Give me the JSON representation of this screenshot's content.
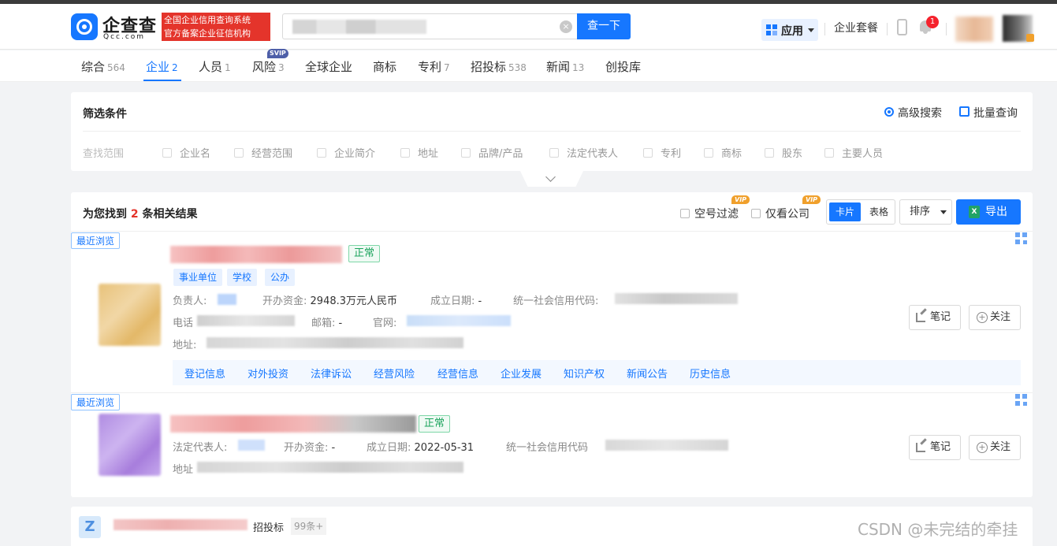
{
  "header": {
    "logo_text": "企查查",
    "logo_sub": "Qcc.com",
    "logo_badge_line1": "全国企业信用查询系统",
    "logo_badge_line2": "官方备案企业征信机构",
    "search_button": "查一下",
    "clear_icon": "×",
    "apps_label": "应用",
    "package_link": "企业套餐",
    "notification_count": "1"
  },
  "tabs": [
    {
      "label": "综合",
      "count": "564"
    },
    {
      "label": "企业",
      "count": "2"
    },
    {
      "label": "人员",
      "count": "1"
    },
    {
      "label": "风险",
      "count": "3"
    },
    {
      "label": "全球企业",
      "count": ""
    },
    {
      "label": "商标",
      "count": ""
    },
    {
      "label": "专利",
      "count": "7"
    },
    {
      "label": "招投标",
      "count": "538"
    },
    {
      "label": "新闻",
      "count": "13"
    },
    {
      "label": "创投库",
      "count": ""
    }
  ],
  "risk_badge": "SVIP",
  "filter": {
    "title": "筛选条件",
    "advanced_search": "高级搜索",
    "batch_query": "批量查询",
    "scope_label": "查找范围",
    "options": [
      "企业名",
      "经营范围",
      "企业简介",
      "地址",
      "品牌/产品",
      "法定代表人",
      "专利",
      "商标",
      "股东",
      "主要人员"
    ]
  },
  "results": {
    "summary_prefix": "为您找到",
    "summary_count": "2",
    "summary_suffix": "条相关结果",
    "empty_filter": "空号过滤",
    "company_only": "仅看公司",
    "vip_tag": "VIP",
    "view_card": "卡片",
    "view_table": "表格",
    "sort_label": "排序",
    "export_label": "导出",
    "excel_icon_letter": "X"
  },
  "companies": [
    {
      "recent_tag": "最近浏览",
      "status": "正常",
      "chips": [
        "事业单位",
        "学校",
        "公办"
      ],
      "principal_label": "负责人:",
      "capital_label": "开办资金:",
      "capital_value": "2948.3万元人民币",
      "founded_label": "成立日期:",
      "founded_value": "-",
      "credit_code_label": "统一社会信用代码:",
      "phone_label": "电话",
      "email_label": "邮箱:",
      "email_value": "-",
      "website_label": "官网:",
      "address_label": "地址:",
      "links": [
        "登记信息",
        "对外投资",
        "法律诉讼",
        "经营风险",
        "经营信息",
        "企业发展",
        "知识产权",
        "新闻公告",
        "历史信息"
      ],
      "note_button": "笔记",
      "follow_button": "关注"
    },
    {
      "recent_tag": "最近浏览",
      "status": "正常",
      "legal_rep_label": "法定代表人:",
      "capital_label": "开办资金:",
      "capital_value": "-",
      "founded_label": "成立日期:",
      "founded_value": "2022-05-31",
      "credit_code_label": "统一社会信用代码",
      "address_label": "地址",
      "note_button": "笔记",
      "follow_button": "关注"
    }
  ],
  "bottom_item": {
    "icon_letter": "Z",
    "label": "招投标",
    "count": "99条+"
  },
  "watermark": "CSDN @未完结的牵挂",
  "colors": {
    "brand_blue": "#1677ff",
    "badge_red": "#e4342b",
    "status_green": "#19a35b",
    "vip_orange": "#f0a02c"
  }
}
